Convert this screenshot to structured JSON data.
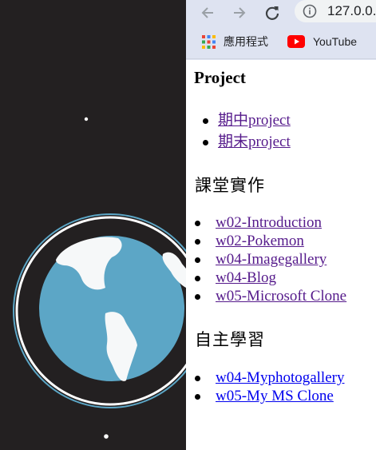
{
  "browser": {
    "url": "127.0.0.",
    "bookmarks": [
      {
        "label": "應用程式",
        "icon": "apps-grid-icon"
      },
      {
        "label": "YouTube",
        "icon": "youtube-icon"
      }
    ]
  },
  "page": {
    "project_heading": "Project",
    "project_links": [
      "期中project",
      "期末project"
    ],
    "classwork_heading": "課堂實作",
    "classwork_links": [
      "w02-Introduction",
      "w02-Pokemon",
      "w04-Imagegallery",
      "w04-Blog",
      "w05-Microsoft Clone"
    ],
    "self_study_heading": "自主學習",
    "self_study_links": [
      "w04-Myphotogallery",
      "w05-My MS Clone"
    ]
  },
  "colors": {
    "scene_bg": "#232021",
    "earth_ocean": "#5ca6c6",
    "earth_land": "#f6f8f9",
    "chrome_bg": "#dee3f1",
    "visited_link": "#551a8b",
    "unvisited_link": "#0000ee"
  }
}
